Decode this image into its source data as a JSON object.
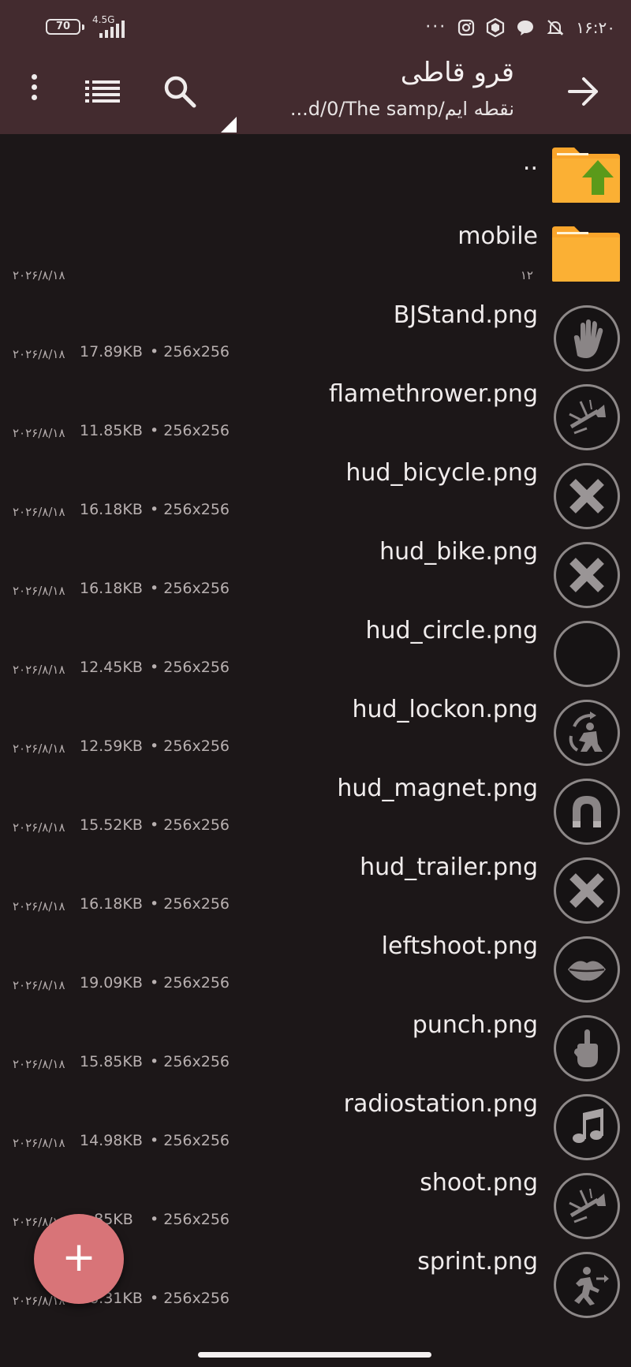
{
  "status_bar": {
    "battery": "70",
    "network": "4.5G",
    "more_dots": "···",
    "time": "۱۶:۲۰"
  },
  "toolbar": {
    "title": "قرو قاطی",
    "path": "...d/0/The samp/نقطه ایم"
  },
  "parent": {
    "name": ".."
  },
  "folder": {
    "name": "mobile",
    "count": "۱۲",
    "date": "۲۰۲۶/۸/۱۸"
  },
  "files": [
    {
      "name": "BJStand.png",
      "date": "۲۰۲۶/۸/۱۸",
      "size": "17.89KB",
      "dims": "• 256x256",
      "icon": "hand-icon"
    },
    {
      "name": "flamethrower.png",
      "date": "۲۰۲۶/۸/۱۸",
      "size": "11.85KB",
      "dims": "• 256x256",
      "icon": "flamethrower-icon"
    },
    {
      "name": "hud_bicycle.png",
      "date": "۲۰۲۶/۸/۱۸",
      "size": "16.18KB",
      "dims": "• 256x256",
      "icon": "x-icon"
    },
    {
      "name": "hud_bike.png",
      "date": "۲۰۲۶/۸/۱۸",
      "size": "16.18KB",
      "dims": "• 256x256",
      "icon": "x-icon"
    },
    {
      "name": "hud_circle.png",
      "date": "۲۰۲۶/۸/۱۸",
      "size": "12.45KB",
      "dims": "• 256x256",
      "icon": "empty-circle-icon"
    },
    {
      "name": "hud_lockon.png",
      "date": "۲۰۲۶/۸/۱۸",
      "size": "12.59KB",
      "dims": "• 256x256",
      "icon": "lockon-icon"
    },
    {
      "name": "hud_magnet.png",
      "date": "۲۰۲۶/۸/۱۸",
      "size": "15.52KB",
      "dims": "• 256x256",
      "icon": "magnet-icon"
    },
    {
      "name": "hud_trailer.png",
      "date": "۲۰۲۶/۸/۱۸",
      "size": "16.18KB",
      "dims": "• 256x256",
      "icon": "x-icon"
    },
    {
      "name": "leftshoot.png",
      "date": "۲۰۲۶/۸/۱۸",
      "size": "19.09KB",
      "dims": "• 256x256",
      "icon": "lips-icon"
    },
    {
      "name": "punch.png",
      "date": "۲۰۲۶/۸/۱۸",
      "size": "15.85KB",
      "dims": "• 256x256",
      "icon": "hand-gesture-icon"
    },
    {
      "name": "radiostation.png",
      "date": "۲۰۲۶/۸/۱۸",
      "size": "14.98KB",
      "dims": "• 256x256",
      "icon": "music-note-icon"
    },
    {
      "name": "shoot.png",
      "date": "۲۰۲۶/۸/۱۸",
      "size": "...85KB",
      "dims": "• 256x256",
      "icon": "flamethrower-icon"
    },
    {
      "name": "sprint.png",
      "date": "۲۰۲۶/۸/۱۸",
      "size": "16.31KB",
      "dims": "• 256x256",
      "icon": "sprint-icon"
    }
  ],
  "fab": {
    "label": "+"
  },
  "colors": {
    "toolbar_bg": "#432b2f",
    "list_bg": "#1c1718",
    "fab": "#d87478",
    "folder": "#f9a52b",
    "folder_arrow": "#5b9a1a"
  }
}
